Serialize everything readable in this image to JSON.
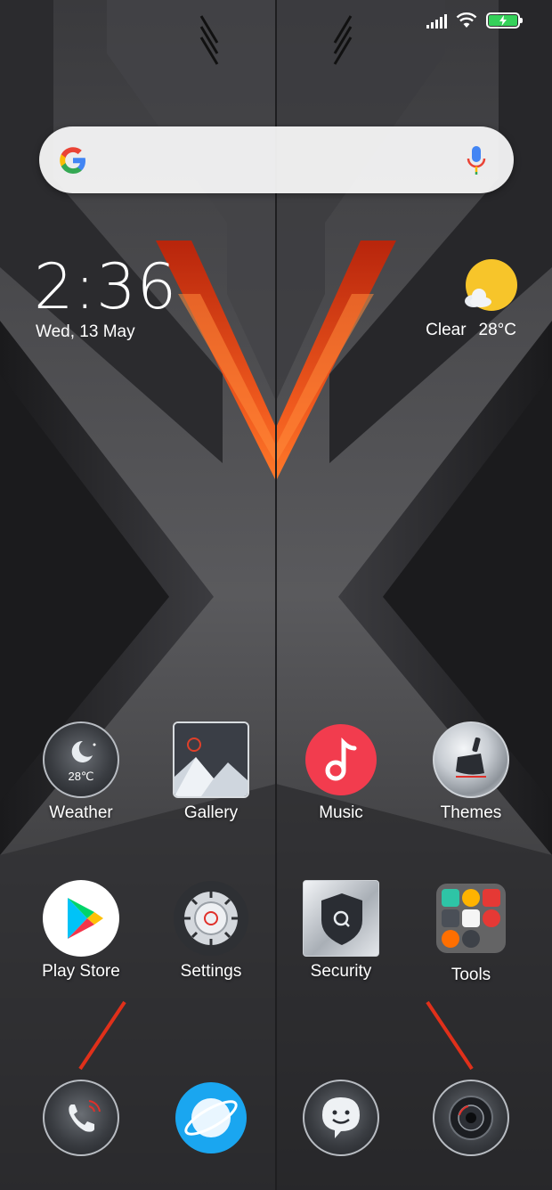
{
  "status_bar": {
    "signal_bars": 5,
    "wifi_icon": "wifi-icon",
    "battery_icon": "battery-charging-icon",
    "battery_color": "#35d15a"
  },
  "search": {
    "logo_icon": "google-g-icon",
    "mic_icon": "microphone-icon"
  },
  "clock": {
    "time": "2:36",
    "date": "Wed, 13 May"
  },
  "weather_widget": {
    "icon": "sun-cloud-icon",
    "condition": "Clear",
    "temperature": "28°C"
  },
  "apps": [
    {
      "label": "Weather",
      "icon": "moon-weather-icon",
      "badge": "28℃"
    },
    {
      "label": "Gallery",
      "icon": "gallery-mountain-icon"
    },
    {
      "label": "Music",
      "icon": "music-note-icon"
    },
    {
      "label": "Themes",
      "icon": "paintbrush-icon"
    },
    {
      "label": "Play Store",
      "icon": "play-store-icon"
    },
    {
      "label": "Settings",
      "icon": "gear-icon"
    },
    {
      "label": "Security",
      "icon": "shield-icon"
    },
    {
      "label": "Tools",
      "icon": "folder-icon"
    }
  ],
  "dock": [
    {
      "icon": "phone-icon"
    },
    {
      "icon": "browser-planet-icon"
    },
    {
      "icon": "messaging-smile-icon"
    },
    {
      "icon": "camera-icon"
    }
  ],
  "colors": {
    "accent_red": "#e8401a",
    "music_red": "#f23c4e",
    "browser_blue": "#1aa6f0"
  }
}
